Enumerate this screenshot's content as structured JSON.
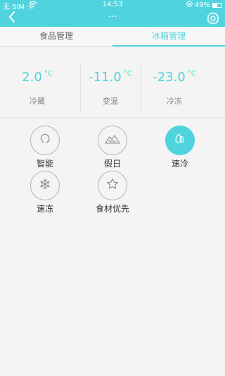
{
  "status_bar": {
    "carrier": "无 SIM 卡",
    "time": "14:53",
    "battery_text": "49%",
    "battery_level": 0.49
  },
  "nav": {
    "title": "···",
    "back_icon": "chevron-left-icon",
    "settings_icon": "gear-icon"
  },
  "tabs": [
    {
      "label": "食品管理",
      "active": false
    },
    {
      "label": "冰箱管理",
      "active": true
    }
  ],
  "compartments": [
    {
      "value": "2.0",
      "unit": "°C",
      "label": "冷藏"
    },
    {
      "value": "-11.0",
      "unit": "°C",
      "label": "变温"
    },
    {
      "value": "-23.0",
      "unit": "°C",
      "label": "冷冻"
    }
  ],
  "modes": [
    {
      "label": "智能",
      "icon": "head-icon",
      "active": false
    },
    {
      "label": "假日",
      "icon": "mountain-icon",
      "active": false
    },
    {
      "label": "速冷",
      "icon": "water-drops-icon",
      "active": true
    },
    {
      "label": "速冻",
      "icon": "snowflake-icon",
      "active": false
    },
    {
      "label": "食材优先",
      "icon": "star-icon",
      "active": false
    }
  ],
  "colors": {
    "accent": "#4fd4dd",
    "background": "#f4f4f4"
  }
}
